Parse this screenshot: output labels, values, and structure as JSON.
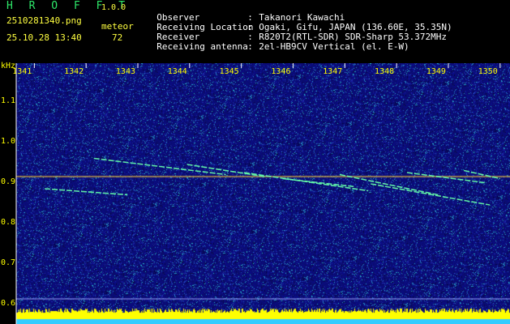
{
  "app": {
    "title": "H R O F F T",
    "version": "1.0.0"
  },
  "file": {
    "name": "2510281340.png",
    "timestamp": "25.10.28 13:40"
  },
  "meteor": {
    "label": "meteor",
    "count": "72"
  },
  "station_info": [
    {
      "label": "Observer",
      "value": "Takanori Kawachi"
    },
    {
      "label": "Receiving Location",
      "value": "Ogaki, Gifu, JAPAN (136.60E, 35.35N)"
    },
    {
      "label": "Receiver",
      "value": "R820T2(RTL-SDR) SDR-Sharp 53.372MHz"
    },
    {
      "label": "Receiving antenna",
      "value": "2el-HB9CV Vertical (el. E-W)"
    }
  ],
  "chart_data": {
    "type": "heatmap",
    "ylabel": "kHz",
    "x_ticks": [
      "1341",
      "1342",
      "1343",
      "1344",
      "1345",
      "1346",
      "1347",
      "1348",
      "1349",
      "1350"
    ],
    "y_ticks": [
      "1.1",
      "1.0",
      "0.9",
      "0.8",
      "0.7",
      "0.6"
    ],
    "x_range": [
      1340.65,
      1350.05
    ],
    "y_range": [
      0.59,
      1.19
    ],
    "carrier_khz": 0.91,
    "meteor_traces": [
      {
        "x": [
          1342.15,
          1344.7
        ],
        "y": [
          0.955,
          0.915
        ]
      },
      {
        "x": [
          1343.95,
          1345.45
        ],
        "y": [
          0.94,
          0.91
        ]
      },
      {
        "x": [
          1345.05,
          1347.45
        ],
        "y": [
          0.92,
          0.875
        ]
      },
      {
        "x": [
          1345.8,
          1347.2
        ],
        "y": [
          0.905,
          0.885
        ]
      },
      {
        "x": [
          1346.9,
          1348.8
        ],
        "y": [
          0.915,
          0.865
        ]
      },
      {
        "x": [
          1347.5,
          1349.8
        ],
        "y": [
          0.892,
          0.84
        ]
      },
      {
        "x": [
          1348.2,
          1349.7
        ],
        "y": [
          0.92,
          0.895
        ]
      },
      {
        "x": [
          1349.3,
          1350.0
        ],
        "y": [
          0.925,
          0.905
        ]
      },
      {
        "x": [
          1341.2,
          1342.8
        ],
        "y": [
          0.88,
          0.865
        ]
      }
    ],
    "grid": false,
    "colors": {
      "background": "#0a0c6a",
      "carrier": "#ffcc33",
      "trace": "#66ffaa",
      "axis_text": "#ffff00",
      "level_bar": "#ffff00",
      "baseline": "#33ccff"
    }
  }
}
